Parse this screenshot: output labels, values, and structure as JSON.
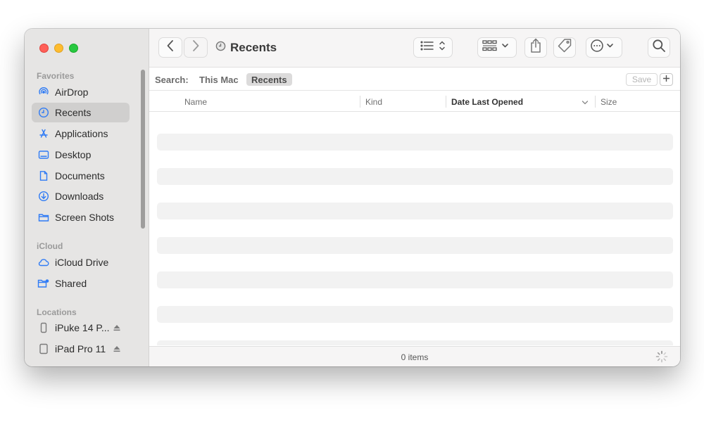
{
  "window": {
    "title": "Recents"
  },
  "sidebar": {
    "sections": [
      {
        "header": "Favorites",
        "items": [
          {
            "label": "AirDrop",
            "icon": "airdrop-icon"
          },
          {
            "label": "Recents",
            "icon": "clock-icon",
            "selected": true
          },
          {
            "label": "Applications",
            "icon": "applications-icon"
          },
          {
            "label": "Desktop",
            "icon": "desktop-icon"
          },
          {
            "label": "Documents",
            "icon": "document-icon"
          },
          {
            "label": "Downloads",
            "icon": "download-icon"
          },
          {
            "label": "Screen Shots",
            "icon": "folder-icon"
          }
        ]
      },
      {
        "header": "iCloud",
        "items": [
          {
            "label": "iCloud Drive",
            "icon": "cloud-icon"
          },
          {
            "label": "Shared",
            "icon": "shared-folder-icon"
          }
        ]
      },
      {
        "header": "Locations",
        "items": [
          {
            "label": "iPuke 14 P...",
            "icon": "iphone-icon",
            "eject": true
          },
          {
            "label": "iPad Pro 11",
            "icon": "ipad-icon",
            "eject": true
          }
        ]
      }
    ]
  },
  "toolbar": {
    "back_icon": "chevron-left-icon",
    "forward_icon": "chevron-right-icon",
    "view_icon": "list-view-icon",
    "group_icon": "group-grid-icon",
    "share_icon": "share-icon",
    "tag_icon": "tag-icon",
    "more_icon": "ellipsis-circle-icon",
    "search_icon": "search-icon"
  },
  "search": {
    "label": "Search:",
    "scopes": [
      "This Mac",
      "Recents"
    ],
    "selected_scope": "Recents",
    "save_label": "Save",
    "add_label": "+"
  },
  "columns": {
    "name": "Name",
    "kind": "Kind",
    "date_last_opened": "Date Last Opened",
    "size": "Size",
    "sorted_by": "Date Last Opened"
  },
  "status": {
    "items_text": "0 items"
  },
  "colors": {
    "accent": "#2f7bf5",
    "sidebar_bg": "#e6e5e4",
    "selected_bg": "#d0cfce",
    "close": "#ff5f57",
    "minimize": "#febc2e",
    "maximize": "#28c840"
  }
}
